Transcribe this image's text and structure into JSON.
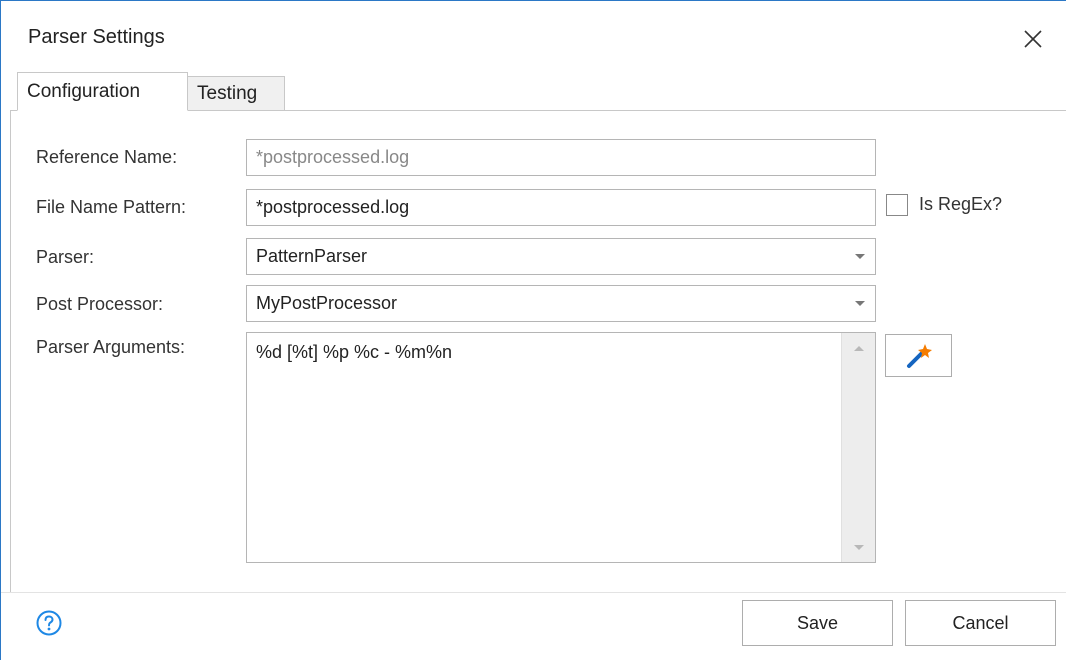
{
  "window": {
    "title": "Parser Settings"
  },
  "tabs": [
    {
      "label": "Configuration",
      "active": true
    },
    {
      "label": "Testing",
      "active": false
    }
  ],
  "form": {
    "reference_name": {
      "label": "Reference Name:",
      "value": "*postprocessed.log"
    },
    "file_name_pattern": {
      "label": "File Name Pattern:",
      "value": "*postprocessed.log"
    },
    "is_regex": {
      "label": "Is RegEx?",
      "checked": false
    },
    "parser": {
      "label": "Parser:",
      "value": "PatternParser"
    },
    "post_processor": {
      "label": "Post Processor:",
      "value": "MyPostProcessor"
    },
    "parser_arguments": {
      "label": "Parser Arguments:",
      "value": "%d [%t] %p %c - %m%n"
    }
  },
  "icons": {
    "close": "close-icon",
    "help": "help-icon",
    "wand": "magic-wand-icon"
  },
  "colors": {
    "accent": "#2b78c6",
    "help_icon": "#1e88e5",
    "wand_handle": "#1565c0",
    "wand_star": "#f57c00"
  },
  "footer": {
    "save_label": "Save",
    "cancel_label": "Cancel"
  }
}
